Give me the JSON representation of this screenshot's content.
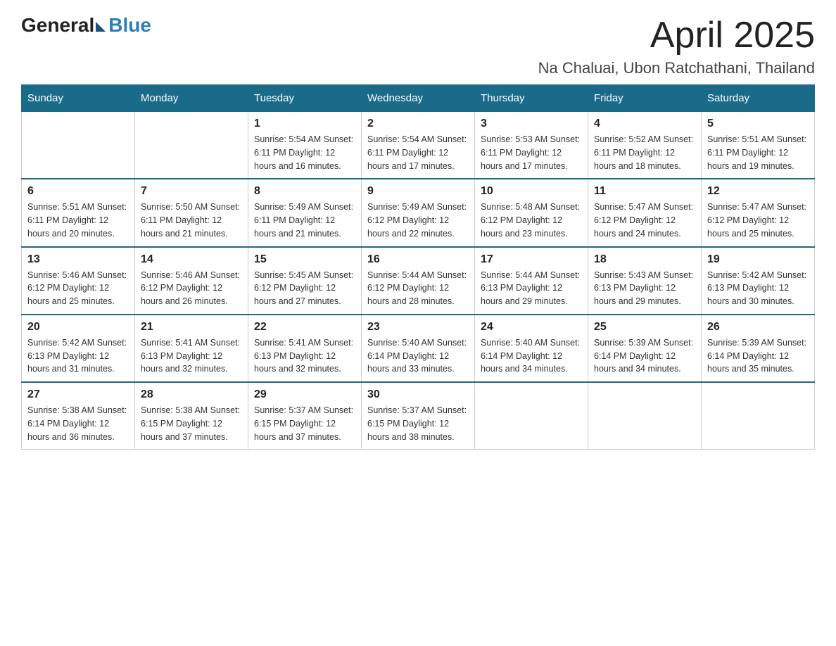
{
  "logo": {
    "general": "General",
    "blue": "Blue"
  },
  "header": {
    "title": "April 2025",
    "subtitle": "Na Chaluai, Ubon Ratchathani, Thailand"
  },
  "weekdays": [
    "Sunday",
    "Monday",
    "Tuesday",
    "Wednesday",
    "Thursday",
    "Friday",
    "Saturday"
  ],
  "weeks": [
    [
      {
        "day": "",
        "info": ""
      },
      {
        "day": "",
        "info": ""
      },
      {
        "day": "1",
        "info": "Sunrise: 5:54 AM\nSunset: 6:11 PM\nDaylight: 12 hours\nand 16 minutes."
      },
      {
        "day": "2",
        "info": "Sunrise: 5:54 AM\nSunset: 6:11 PM\nDaylight: 12 hours\nand 17 minutes."
      },
      {
        "day": "3",
        "info": "Sunrise: 5:53 AM\nSunset: 6:11 PM\nDaylight: 12 hours\nand 17 minutes."
      },
      {
        "day": "4",
        "info": "Sunrise: 5:52 AM\nSunset: 6:11 PM\nDaylight: 12 hours\nand 18 minutes."
      },
      {
        "day": "5",
        "info": "Sunrise: 5:51 AM\nSunset: 6:11 PM\nDaylight: 12 hours\nand 19 minutes."
      }
    ],
    [
      {
        "day": "6",
        "info": "Sunrise: 5:51 AM\nSunset: 6:11 PM\nDaylight: 12 hours\nand 20 minutes."
      },
      {
        "day": "7",
        "info": "Sunrise: 5:50 AM\nSunset: 6:11 PM\nDaylight: 12 hours\nand 21 minutes."
      },
      {
        "day": "8",
        "info": "Sunrise: 5:49 AM\nSunset: 6:11 PM\nDaylight: 12 hours\nand 21 minutes."
      },
      {
        "day": "9",
        "info": "Sunrise: 5:49 AM\nSunset: 6:12 PM\nDaylight: 12 hours\nand 22 minutes."
      },
      {
        "day": "10",
        "info": "Sunrise: 5:48 AM\nSunset: 6:12 PM\nDaylight: 12 hours\nand 23 minutes."
      },
      {
        "day": "11",
        "info": "Sunrise: 5:47 AM\nSunset: 6:12 PM\nDaylight: 12 hours\nand 24 minutes."
      },
      {
        "day": "12",
        "info": "Sunrise: 5:47 AM\nSunset: 6:12 PM\nDaylight: 12 hours\nand 25 minutes."
      }
    ],
    [
      {
        "day": "13",
        "info": "Sunrise: 5:46 AM\nSunset: 6:12 PM\nDaylight: 12 hours\nand 25 minutes."
      },
      {
        "day": "14",
        "info": "Sunrise: 5:46 AM\nSunset: 6:12 PM\nDaylight: 12 hours\nand 26 minutes."
      },
      {
        "day": "15",
        "info": "Sunrise: 5:45 AM\nSunset: 6:12 PM\nDaylight: 12 hours\nand 27 minutes."
      },
      {
        "day": "16",
        "info": "Sunrise: 5:44 AM\nSunset: 6:12 PM\nDaylight: 12 hours\nand 28 minutes."
      },
      {
        "day": "17",
        "info": "Sunrise: 5:44 AM\nSunset: 6:13 PM\nDaylight: 12 hours\nand 29 minutes."
      },
      {
        "day": "18",
        "info": "Sunrise: 5:43 AM\nSunset: 6:13 PM\nDaylight: 12 hours\nand 29 minutes."
      },
      {
        "day": "19",
        "info": "Sunrise: 5:42 AM\nSunset: 6:13 PM\nDaylight: 12 hours\nand 30 minutes."
      }
    ],
    [
      {
        "day": "20",
        "info": "Sunrise: 5:42 AM\nSunset: 6:13 PM\nDaylight: 12 hours\nand 31 minutes."
      },
      {
        "day": "21",
        "info": "Sunrise: 5:41 AM\nSunset: 6:13 PM\nDaylight: 12 hours\nand 32 minutes."
      },
      {
        "day": "22",
        "info": "Sunrise: 5:41 AM\nSunset: 6:13 PM\nDaylight: 12 hours\nand 32 minutes."
      },
      {
        "day": "23",
        "info": "Sunrise: 5:40 AM\nSunset: 6:14 PM\nDaylight: 12 hours\nand 33 minutes."
      },
      {
        "day": "24",
        "info": "Sunrise: 5:40 AM\nSunset: 6:14 PM\nDaylight: 12 hours\nand 34 minutes."
      },
      {
        "day": "25",
        "info": "Sunrise: 5:39 AM\nSunset: 6:14 PM\nDaylight: 12 hours\nand 34 minutes."
      },
      {
        "day": "26",
        "info": "Sunrise: 5:39 AM\nSunset: 6:14 PM\nDaylight: 12 hours\nand 35 minutes."
      }
    ],
    [
      {
        "day": "27",
        "info": "Sunrise: 5:38 AM\nSunset: 6:14 PM\nDaylight: 12 hours\nand 36 minutes."
      },
      {
        "day": "28",
        "info": "Sunrise: 5:38 AM\nSunset: 6:15 PM\nDaylight: 12 hours\nand 37 minutes."
      },
      {
        "day": "29",
        "info": "Sunrise: 5:37 AM\nSunset: 6:15 PM\nDaylight: 12 hours\nand 37 minutes."
      },
      {
        "day": "30",
        "info": "Sunrise: 5:37 AM\nSunset: 6:15 PM\nDaylight: 12 hours\nand 38 minutes."
      },
      {
        "day": "",
        "info": ""
      },
      {
        "day": "",
        "info": ""
      },
      {
        "day": "",
        "info": ""
      }
    ]
  ]
}
